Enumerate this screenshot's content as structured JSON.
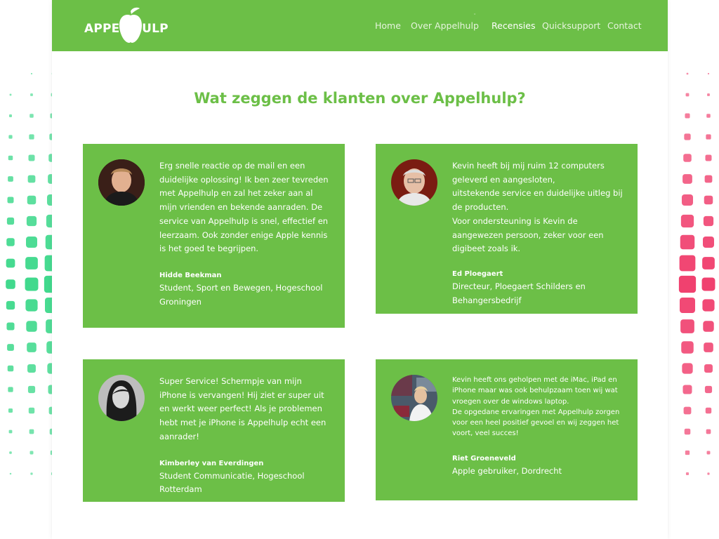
{
  "brand": {
    "logo_text": "APPEL HULP",
    "primary_color": "#6cbf47",
    "left_pattern_color": "#3fd98c",
    "right_pattern_color": "#f0406e"
  },
  "nav": {
    "items": [
      {
        "label": "Home",
        "active": false
      },
      {
        "label": "Over Appelhulp",
        "active": false,
        "has_submenu": true
      },
      {
        "label": "Recensies",
        "active": true
      },
      {
        "label": "Quicksupport",
        "active": false
      },
      {
        "label": "Contact",
        "active": false
      }
    ]
  },
  "page": {
    "title": "Wat zeggen de klanten over Appelhulp?"
  },
  "testimonials": [
    {
      "quote": "Erg snelle reactie op de mail en een duidelijke oplossing! Ik ben zeer tevreden met Appelhulp en zal het zeker aan al mijn vrienden en bekende aanraden. De service van Appelhulp is snel, effectief en leerzaam. Ook zonder enige Apple kennis is het goed te begrijpen.",
      "name": "Hidde Beekman",
      "role": "Student, Sport en Bewegen, Hogeschool Groningen"
    },
    {
      "quote": "Kevin heeft bij mij ruim 12 computers geleverd en aangesloten,\nuitstekende service en duidelijke uitleg bij de producten.\nVoor ondersteuning is Kevin de aangewezen persoon, zeker voor een digibeet zoals ik.",
      "name": "Ed Ploegaert",
      "role": "Directeur, Ploegaert Schilders en Behangersbedrijf"
    },
    {
      "quote": "Super Service! Schermpje van mijn iPhone is vervangen! Hij ziet er super uit en werkt weer perfect! Als je problemen hebt met je iPhone is Appelhulp echt een aanrader!",
      "name": "Kimberley van Everdingen",
      "role": "Student Communicatie, Hogeschool Rotterdam"
    },
    {
      "quote": "Kevin heeft ons geholpen met de iMac, iPad en iPhone maar was ook behulpzaam toen wij wat vroegen over de windows laptop.\nDe opgedane ervaringen met Appelhulp zorgen voor een heel positief gevoel en wij zeggen het voort, veel succes!",
      "name": "Riet Groeneveld",
      "role": "Apple gebruiker, Dordrecht"
    }
  ]
}
